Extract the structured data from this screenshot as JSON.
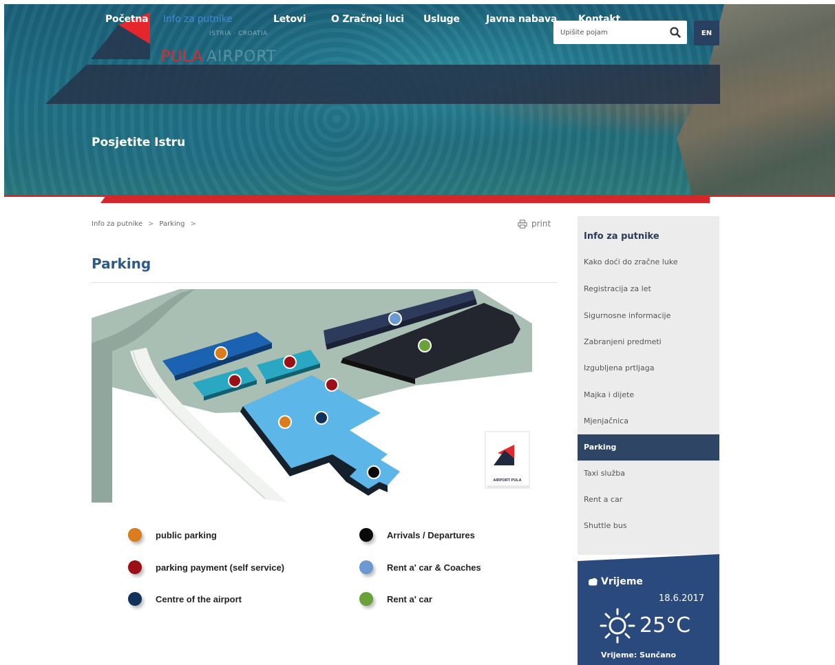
{
  "header": {
    "logo_pula": "PULA",
    "logo_airport": "AIRPORT",
    "logo_tagline": "ISTRIA · CROATIA",
    "search_placeholder": "Upišite pojam",
    "lang": "EN",
    "hero_title": "Posjetite Istru"
  },
  "nav": {
    "items": [
      {
        "label": "Početna"
      },
      {
        "label": "Info za putnike"
      },
      {
        "label": "Letovi"
      },
      {
        "label": "O Zračnoj luci"
      },
      {
        "label": "Usluge"
      },
      {
        "label": "Javna nabava"
      },
      {
        "label": "Kontakt"
      }
    ],
    "active_index": 1
  },
  "breadcrumb": {
    "items": [
      {
        "label": "Info za putnike"
      },
      {
        "label": "Parking"
      }
    ],
    "separator": ">"
  },
  "page": {
    "print_label": "print",
    "title": "Parking"
  },
  "map": {
    "logo_text": "AIRPORT PULA"
  },
  "legend": {
    "items": [
      {
        "label": "public parking",
        "color": "#d97d1e"
      },
      {
        "label": "parking payment (self service)",
        "color": "#9b1016"
      },
      {
        "label": "Centre of the airport",
        "color": "#12325e"
      },
      {
        "label": "Arrivals / Departures",
        "color": "#0a0a0a"
      },
      {
        "label": "Rent a' car & Coaches",
        "color": "#6b9ad2"
      },
      {
        "label": "Rent a' car",
        "color": "#6aa23a"
      }
    ]
  },
  "sidebar": {
    "heading": "Info za putnike",
    "items": [
      {
        "label": "Kako doći do zračne luke"
      },
      {
        "label": "Registracija za let"
      },
      {
        "label": "Sigurnosne informacije"
      },
      {
        "label": "Zabranjeni predmeti"
      },
      {
        "label": "Izgubljena prtljaga"
      },
      {
        "label": "Majka i dijete"
      },
      {
        "label": "Mjenjačnica"
      },
      {
        "label": "Parking"
      },
      {
        "label": "Taxi služba"
      },
      {
        "label": "Rent a car"
      },
      {
        "label": "Shuttle bus"
      }
    ],
    "active_index": 7
  },
  "weather": {
    "title": "Vrijeme",
    "date": "18.6.2017",
    "temperature": "25°C",
    "description": "Vrijeme: Sunčano",
    "icon": "sun-icon"
  },
  "colors": {
    "accent": "#2e4566",
    "brand_red": "#d5262c",
    "nav_active": "#3f8ad8",
    "title_blue": "#2d5a8a"
  }
}
